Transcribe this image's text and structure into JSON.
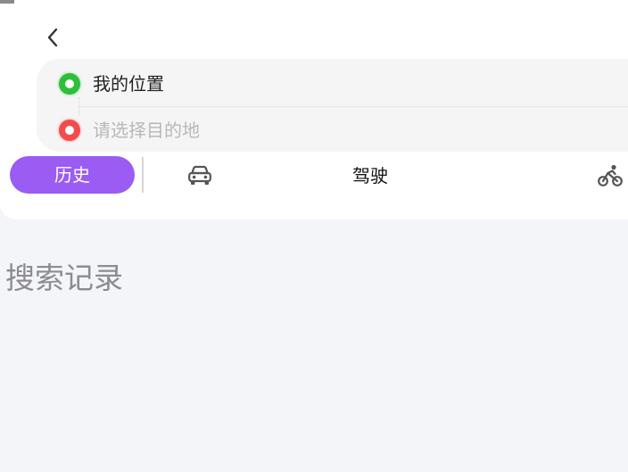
{
  "header": {
    "back_icon": "chevron-left-icon"
  },
  "route": {
    "origin": {
      "icon": "green-location-dot-icon",
      "text": "我的位置"
    },
    "destination": {
      "icon": "red-location-dot-icon",
      "value": "",
      "placeholder": "请选择目的地"
    }
  },
  "tabs": {
    "history_label": "历史",
    "car_icon": "car-icon",
    "drive_label": "驾驶",
    "bike_icon": "cycling-icon"
  },
  "history": {
    "section_title": "搜索记录"
  },
  "colors": {
    "accent": "#9a5cf2",
    "origin_dot": "#2cbf39",
    "destination_dot": "#f24d4d",
    "page_background": "#f4f5f8"
  }
}
